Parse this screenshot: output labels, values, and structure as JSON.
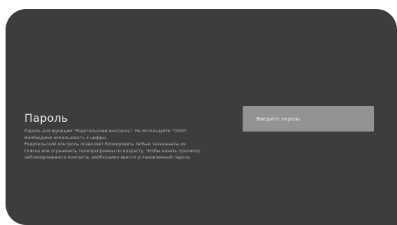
{
  "dialog": {
    "title": "Пароль",
    "description_lines": [
      "Пароль для функции \"Родительский контроль\". Не используйте \"0000\".",
      "Необходимо использовать 4 цифры.",
      "Родительский контроль позволяет блокировать любые телеканалы из",
      "списка или ограничить телепрограммы по возрасту. Чтобы начать просмотр",
      "заблокированного контента, необходимо ввести установленный пароль."
    ],
    "password_field": {
      "placeholder": "Введите пароль",
      "value": ""
    }
  },
  "colors": {
    "panel_background": "#3d3d3d",
    "field_background": "#939393",
    "title_text": "#e6e6e6",
    "description_text": "#b4b4b4"
  }
}
